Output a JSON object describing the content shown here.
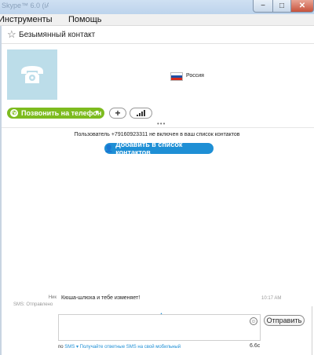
{
  "window": {
    "title": "Skype™ 6.0 (iAB)",
    "controls": {
      "minimize": "−",
      "maximize": "□",
      "close": "✕"
    }
  },
  "menubar": {
    "items": [
      "Инструменты",
      "Помощь"
    ]
  },
  "header": {
    "star_icon": "star-icon",
    "title": "Безымянный контакт"
  },
  "profile": {
    "avatar_icon": "telephone-icon",
    "country": "Россия",
    "flag_colors": [
      "#ffffff",
      "#1f4fa3",
      "#d52b1e"
    ]
  },
  "actions": {
    "call_label": "Позвонить на телефон",
    "add_symbol": "+",
    "call_color": "#7dbb1f"
  },
  "notice": {
    "text": "Пользователь +79160923311 не включен в ваш список контактов",
    "add_button": "Добавить в список контактов",
    "add_color": "#1e8fd5"
  },
  "chat": {
    "nick_label": "Ник",
    "status": "SMS: Отправлено",
    "message": "Кюша-шлюха и тебе изменяет!",
    "time": "10:17 AM"
  },
  "composer": {
    "placeholder": "",
    "send_label": "Отправить",
    "smiley": "☺"
  },
  "footer": {
    "prefix": "по",
    "channel": "SMS",
    "link_text": "Получайте ответные SMS на свой мобильный",
    "counter": "6.6с"
  }
}
